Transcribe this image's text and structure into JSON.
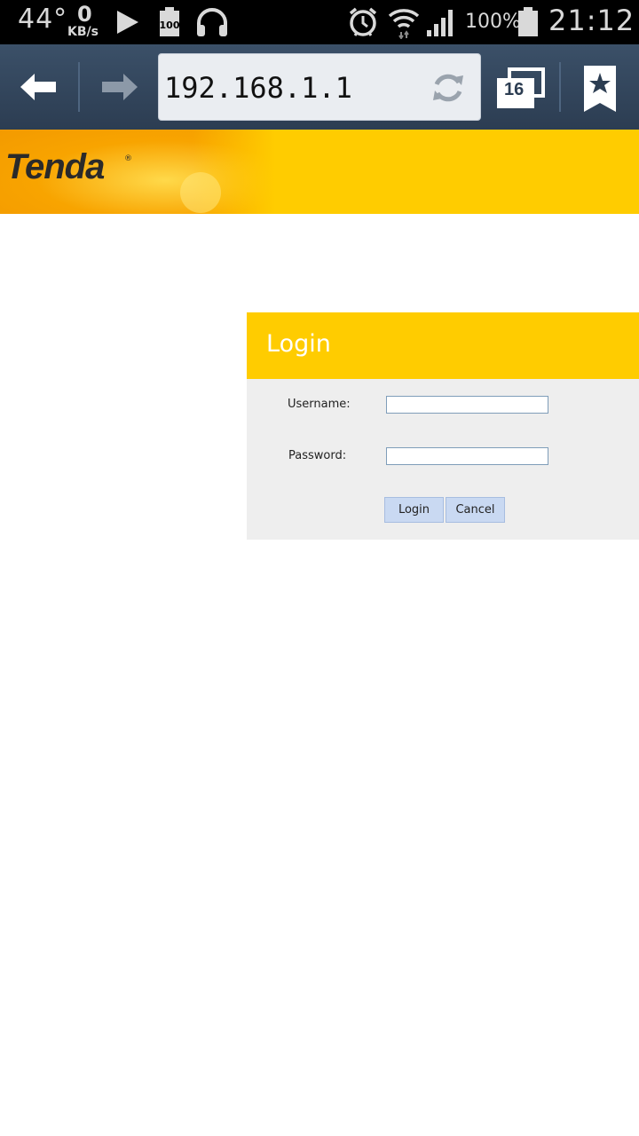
{
  "status_bar": {
    "temperature": "44°",
    "net_speed_value": "0",
    "net_speed_unit": "KB/s",
    "battery_widget_label": "100",
    "battery_percent": "100%",
    "time": "21:12",
    "icons": [
      "play-icon",
      "battery-widget-icon",
      "headphones-icon",
      "alarm-icon",
      "wifi-icon",
      "signal-icon",
      "battery-icon"
    ]
  },
  "browser": {
    "url": "192.168.1.1",
    "tab_count": "16",
    "icons": [
      "back-arrow-icon",
      "forward-arrow-icon",
      "reload-icon",
      "tabs-icon",
      "bookmark-star-icon"
    ]
  },
  "banner": {
    "logo_text": "Tenda",
    "registered_mark": "®",
    "color": "#ffcc00"
  },
  "login": {
    "title": "Login",
    "username_label": "Username:",
    "password_label": "Password:",
    "username_value": "",
    "password_value": "",
    "login_button": "Login",
    "cancel_button": "Cancel",
    "header_color": "#ffcc00",
    "panel_color": "#eeeeee"
  }
}
